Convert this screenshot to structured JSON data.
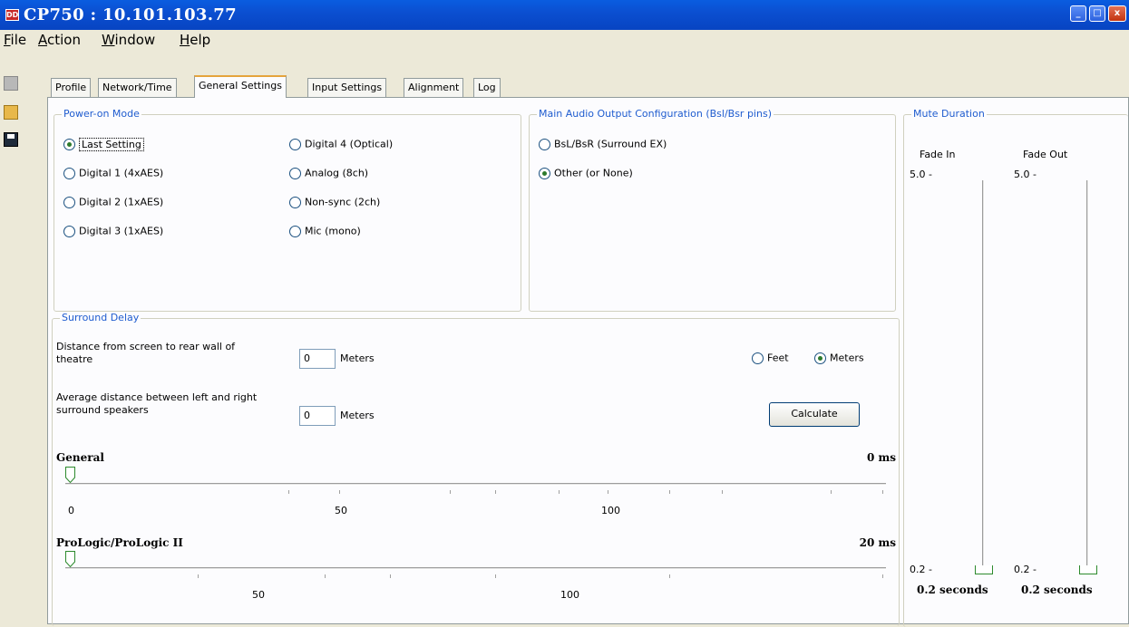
{
  "window": {
    "title": "CP750 : 10.101.103.77"
  },
  "menu": {
    "items": [
      "File",
      "Action",
      "Window",
      "Help"
    ]
  },
  "tabs": [
    "Profile",
    "Network/Time",
    "General Settings",
    "Input Settings",
    "Alignment",
    "Log"
  ],
  "active_tab": "General Settings",
  "power_on_mode": {
    "title": "Power-on Mode",
    "options": [
      "Last Setting",
      "Digital 1 (4xAES)",
      "Digital 2 (1xAES)",
      "Digital 3 (1xAES)",
      "Digital 4 (Optical)",
      "Analog (8ch)",
      "Non-sync (2ch)",
      "Mic (mono)"
    ],
    "selected": "Last Setting"
  },
  "main_audio": {
    "title": "Main Audio Output Configuration (Bsl/Bsr pins)",
    "options": [
      "BsL/BsR (Surround EX)",
      "Other (or None)"
    ],
    "selected": "Other (or None)"
  },
  "mute_duration": {
    "title": "Mute Duration",
    "fade_in": {
      "label": "Fade In",
      "max_label": "5.0 -",
      "min_label": "0.2 -",
      "value_text": "0.2 seconds",
      "value": 0.2
    },
    "fade_out": {
      "label": "Fade Out",
      "max_label": "5.0 -",
      "min_label": "0.2 -",
      "value_text": "0.2 seconds",
      "value": 0.2
    }
  },
  "surround_delay": {
    "title": "Surround Delay",
    "distance_label": "Distance from screen to rear wall of theatre",
    "distance_value": "0",
    "distance_unit": "Meters",
    "average_label": "Average distance between left and right surround speakers",
    "average_value": "0",
    "average_unit": "Meters",
    "unit_options": [
      "Feet",
      "Meters"
    ],
    "unit_selected": "Meters",
    "calculate_label": "Calculate",
    "general": {
      "label": "General",
      "value_text": "0 ms",
      "ticks": [
        "0",
        "50",
        "100"
      ]
    },
    "prologic": {
      "label": "ProLogic/ProLogic II",
      "value_text": "20 ms",
      "ticks": [
        "50",
        "100"
      ]
    }
  }
}
